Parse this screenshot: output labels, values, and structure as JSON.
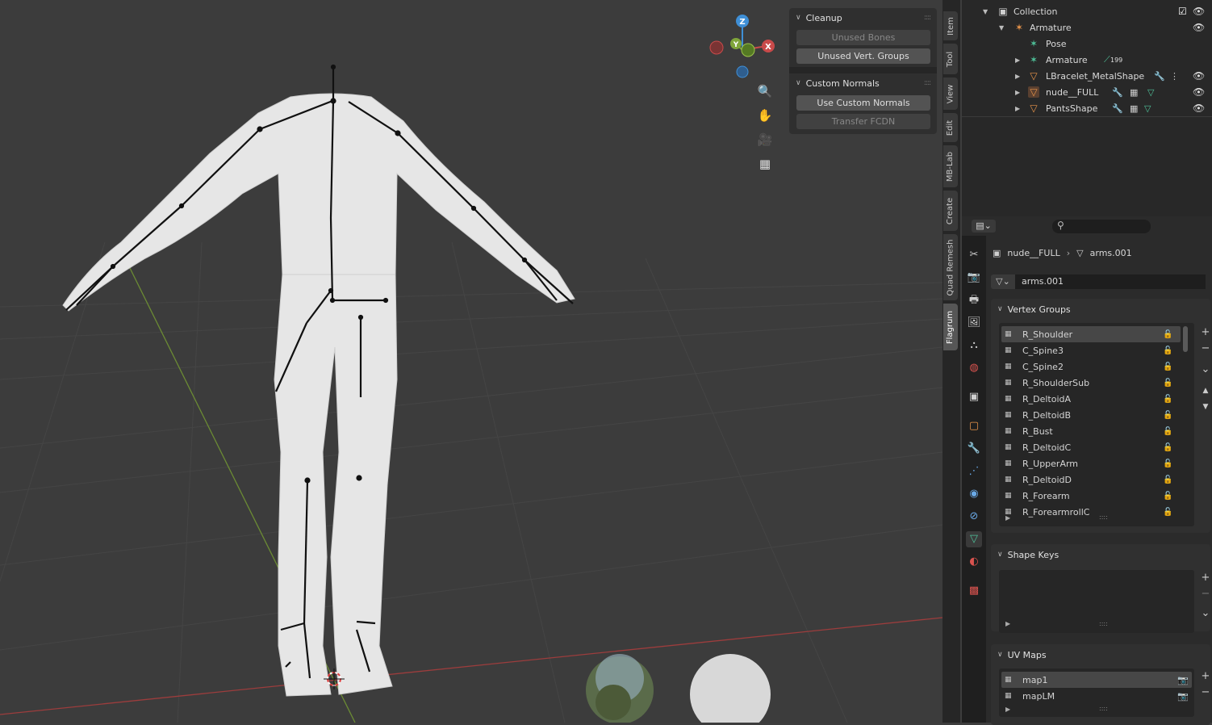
{
  "viewport": {
    "gizmo": {
      "z": "Z",
      "y": "Y",
      "x": "X"
    },
    "nav_icons": [
      "zoom-icon",
      "hand-pan-icon",
      "camera-icon",
      "grid-ortho-icon"
    ]
  },
  "npanel": {
    "cleanup": {
      "title": "Cleanup",
      "unused_bones": "Unused Bones",
      "unused_vert_groups": "Unused Vert. Groups"
    },
    "custom_normals": {
      "title": "Custom Normals",
      "use_custom_normals": "Use Custom Normals",
      "transfer_fcdn": "Transfer FCDN"
    }
  },
  "side_tabs": [
    "Item",
    "Tool",
    "View",
    "Edit",
    "MB-Lab",
    "Create",
    "Quad Remesh",
    "Flagrum"
  ],
  "outliner": {
    "rows": [
      {
        "label": "Collection",
        "icon": "collection-icon"
      },
      {
        "label": "Armature",
        "icon": "armature-icon"
      },
      {
        "label": "Pose",
        "icon": "pose-icon"
      },
      {
        "label": "Armature",
        "icon": "armature-data-icon",
        "badge": "199"
      },
      {
        "label": "LBracelet_MetalShape",
        "icon": "mesh-icon"
      },
      {
        "label": "nude__FULL",
        "icon": "mesh-icon"
      },
      {
        "label": "PantsShape",
        "icon": "mesh-icon"
      }
    ]
  },
  "properties": {
    "breadcrumb": {
      "object": "nude__FULL",
      "data": "arms.001"
    },
    "mesh_name": "arms.001",
    "vertex_groups": {
      "title": "Vertex Groups",
      "items": [
        "R_Shoulder",
        "C_Spine3",
        "C_Spine2",
        "R_ShoulderSub",
        "R_DeltoidA",
        "R_DeltoidB",
        "R_Bust",
        "R_DeltoidC",
        "R_UpperArm",
        "R_DeltoidD",
        "R_Forearm",
        "R_ForearmrollC"
      ]
    },
    "shape_keys": {
      "title": "Shape Keys"
    },
    "uv_maps": {
      "title": "UV Maps",
      "items": [
        "map1",
        "mapLM"
      ]
    }
  },
  "colors": {
    "axis_x": "#c94a4a",
    "axis_y": "#7fa53a",
    "axis_z": "#3f8fd6",
    "mesh": "#e8e8e8"
  }
}
